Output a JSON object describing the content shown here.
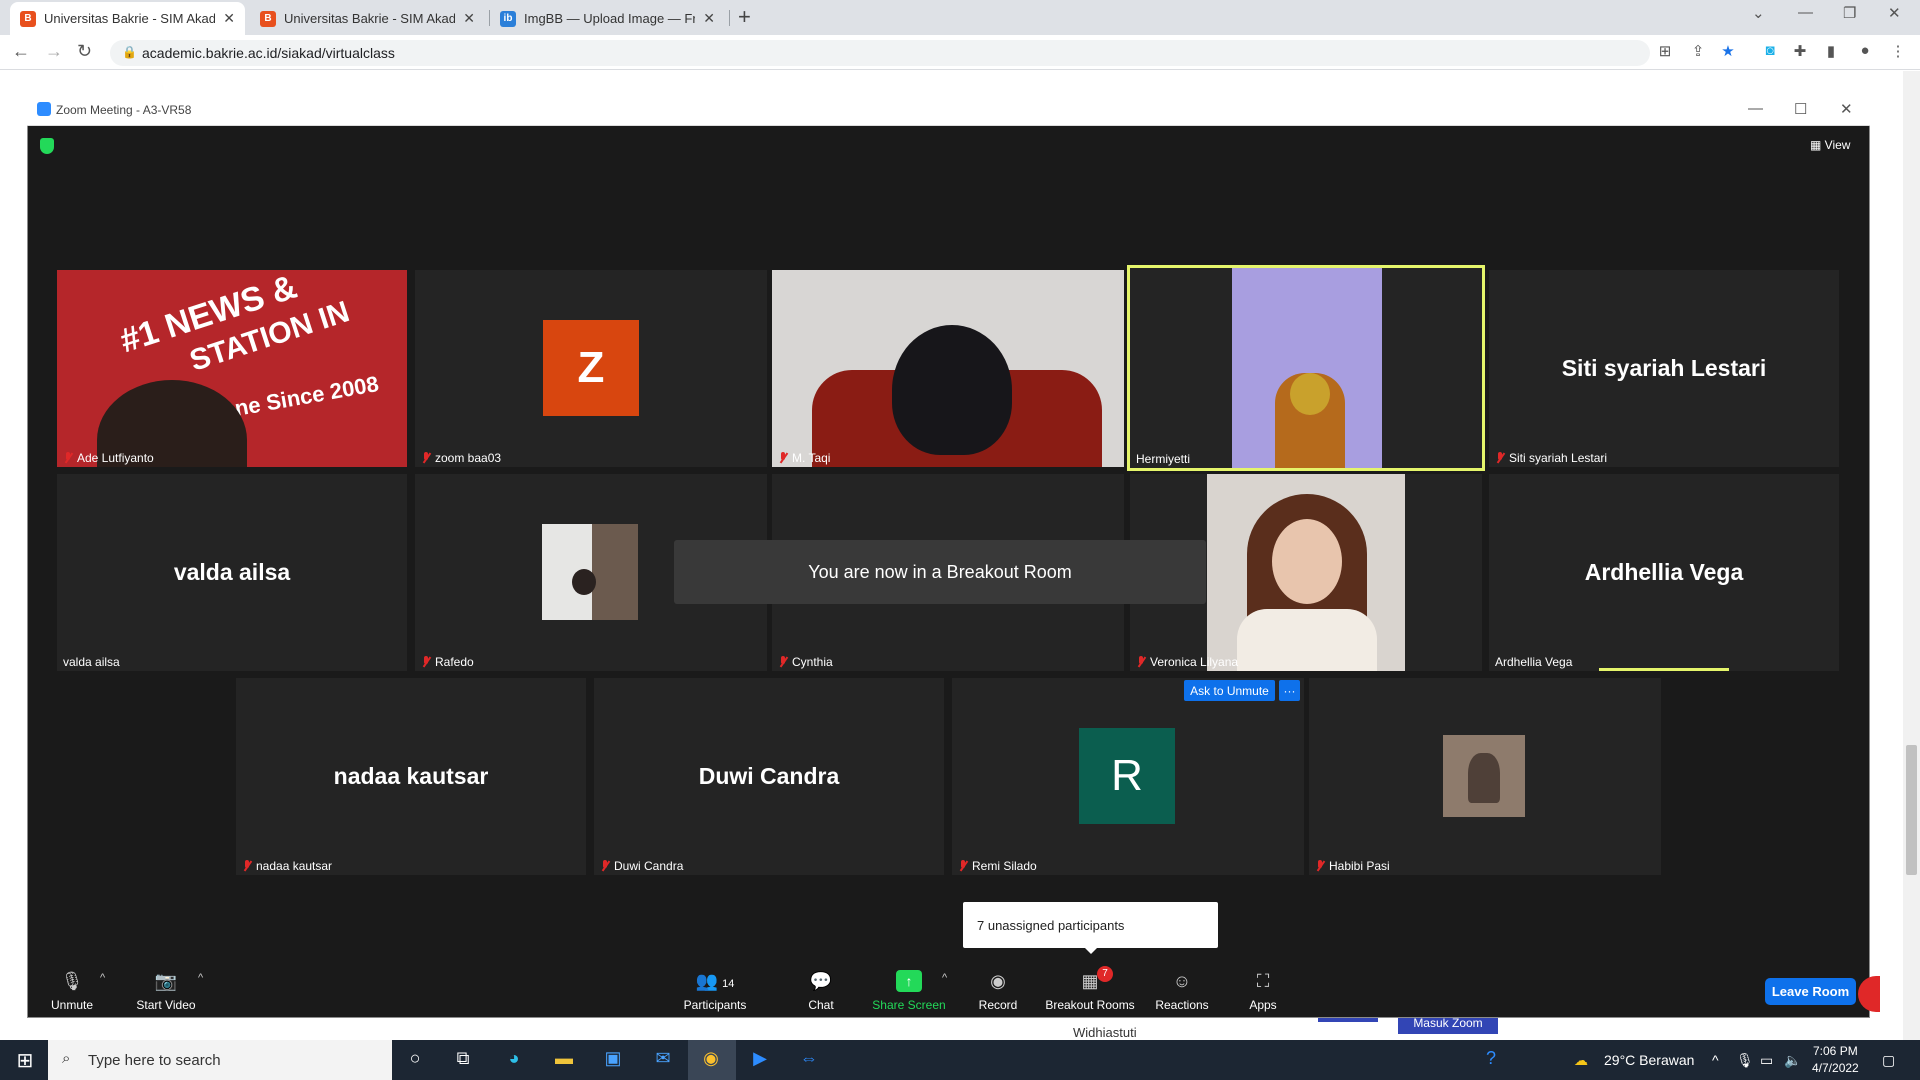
{
  "browser": {
    "tabs": [
      {
        "title": "Universitas Bakrie - SIM Akadem",
        "favicon_color": "#e8501e"
      },
      {
        "title": "Universitas Bakrie - SIM Akadem",
        "favicon_color": "#e8501e"
      },
      {
        "title": "ImgBB — Upload Image — Free",
        "favicon_color": "#2b7fd9"
      }
    ],
    "url": "academic.bakrie.ac.id/siakad/virtualclass"
  },
  "page_behind": {
    "bottom_name": "Widhiastuti",
    "bottom_button": "Masuk Zoom"
  },
  "zoom": {
    "window_title": "Zoom Meeting - A3-VR58",
    "view_label": "View",
    "toast": "You are now in a Breakout Room",
    "ask_unmute": "Ask to Unmute",
    "more": "···",
    "unassigned": "7 unassigned participants",
    "participants": [
      {
        "name": "Ade Lutfiyanto",
        "muted": true,
        "video": true,
        "display": ""
      },
      {
        "name": "zoom baa03",
        "muted": true,
        "video": false,
        "avatar_letter": "Z",
        "avatar_color": "#d8460f"
      },
      {
        "name": "M. Taqi",
        "muted": true,
        "video": true
      },
      {
        "name": "Hermiyetti",
        "muted": false,
        "video": true,
        "speaking": true
      },
      {
        "name": "Siti syariah Lestari",
        "muted": true,
        "video": false,
        "display": "Siti syariah Lestari"
      },
      {
        "name": "valda ailsa",
        "muted": false,
        "video": false,
        "display": "valda ailsa"
      },
      {
        "name": "Rafedo",
        "muted": true,
        "video": true
      },
      {
        "name": "Cynthia",
        "muted": true,
        "video": false,
        "display": "Cynthia"
      },
      {
        "name": "Veronica Lilyana",
        "muted": true,
        "video": true
      },
      {
        "name": "Ardhellia Vega",
        "muted": false,
        "video": false,
        "display": "Ardhellia Vega"
      },
      {
        "name": "nadaa kautsar",
        "muted": true,
        "video": false,
        "display": "nadaa kautsar"
      },
      {
        "name": "Duwi Candra",
        "muted": true,
        "video": false,
        "display": "Duwi Candra"
      },
      {
        "name": "Remi Silado",
        "muted": true,
        "video": false,
        "avatar_letter": "R",
        "avatar_color": "#0b5e4f"
      },
      {
        "name": "Habibi Pasi",
        "muted": true,
        "video": false
      }
    ],
    "toolbar": {
      "unmute": "Unmute",
      "start_video": "Start Video",
      "participants": "Participants",
      "participants_count": "14",
      "chat": "Chat",
      "share_screen": "Share Screen",
      "record": "Record",
      "breakout_rooms": "Breakout Rooms",
      "breakout_badge": "7",
      "reactions": "Reactions",
      "apps": "Apps",
      "leave_room": "Leave Room"
    },
    "news_banner": {
      "line1": "#1 NEWS &",
      "line2": "STATION IN",
      "line3": "One Since 2008"
    }
  },
  "taskbar": {
    "search_placeholder": "Type here to search",
    "weather": "29°C  Berawan",
    "time": "7:06 PM",
    "date": "4/7/2022"
  },
  "colors": {
    "zoom_blue": "#0e71eb",
    "share_green": "#23d959",
    "speaker_border": "#e5f56b",
    "mute_red": "#e02828"
  }
}
